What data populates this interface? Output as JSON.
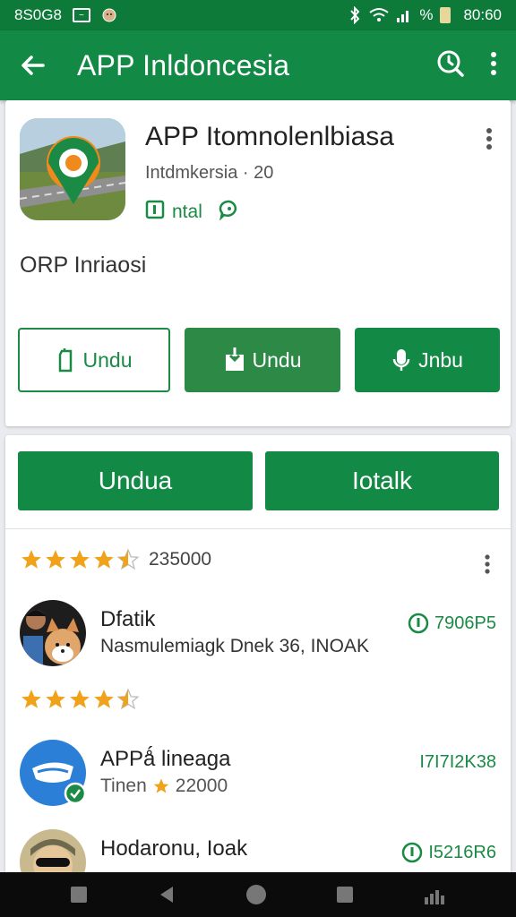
{
  "status_bar": {
    "left_text": "8S0G8",
    "time": "80:60",
    "signal_text": "%"
  },
  "app_bar": {
    "title": "APP Inldoncesia",
    "back_icon": "arrow-back-icon",
    "search_icon": "search-icon",
    "more_icon": "more-vert-icon"
  },
  "app_card": {
    "name": "APP Itomnolenlbiasa",
    "subtitle": "Intdmkersia · 20",
    "tag_label": "ntal",
    "description": "ORP Inriaosi",
    "buttons": [
      {
        "label": "Undu",
        "icon": "phone-icon",
        "style": "outline"
      },
      {
        "label": "Undu",
        "icon": "download-icon",
        "style": "solid"
      },
      {
        "label": "Jnbu",
        "icon": "mic-icon",
        "style": "solid"
      }
    ]
  },
  "actions": {
    "primary": "Undua",
    "secondary": "Iotalk"
  },
  "rating": {
    "stars": 4.5,
    "count": "235000"
  },
  "list": [
    {
      "title": "Dfatik",
      "subtitle": "Nasmulemiagk Dnek 36, INOAK",
      "badge": "7906P5",
      "stars": 4.5
    },
    {
      "title": "APPǻ lineaga",
      "subtitle_prefix": "Tinen",
      "subtitle_value": "22000",
      "badge": "I7I7I2K38"
    },
    {
      "title": "Hodaronu, Ioak",
      "badge": "I5216R6"
    }
  ],
  "colors": {
    "primary": "#128a45",
    "status_bar": "#0e7a3a",
    "star": "#f0a21a"
  }
}
